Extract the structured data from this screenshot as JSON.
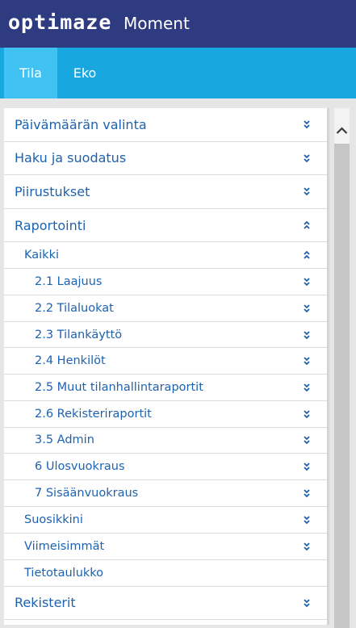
{
  "header": {
    "logo_text": "optimaze",
    "app_title": "Moment"
  },
  "tabs": [
    {
      "label": "Tila",
      "active": true
    },
    {
      "label": "Eko",
      "active": false
    }
  ],
  "menu": [
    {
      "label": "Päivämäärän valinta",
      "level": 0,
      "expanded": false
    },
    {
      "label": "Haku ja suodatus",
      "level": 0,
      "expanded": false
    },
    {
      "label": "Piirustukset",
      "level": 0,
      "expanded": false
    },
    {
      "label": "Raportointi",
      "level": 0,
      "expanded": true
    },
    {
      "label": "Kaikki",
      "level": 1,
      "expanded": true
    },
    {
      "label": "2.1 Laajuus",
      "level": 2,
      "expanded": false
    },
    {
      "label": "2.2 Tilaluokat",
      "level": 2,
      "expanded": false
    },
    {
      "label": "2.3 Tilankäyttö",
      "level": 2,
      "expanded": false
    },
    {
      "label": "2.4 Henkilöt",
      "level": 2,
      "expanded": false
    },
    {
      "label": "2.5 Muut tilanhallintaraportit",
      "level": 2,
      "expanded": false
    },
    {
      "label": "2.6 Rekisteriraportit",
      "level": 2,
      "expanded": false
    },
    {
      "label": "3.5 Admin",
      "level": 2,
      "expanded": false
    },
    {
      "label": "6 Ulosvuokraus",
      "level": 2,
      "expanded": false
    },
    {
      "label": "7 Sisäänvuokraus",
      "level": 2,
      "expanded": false
    },
    {
      "label": "Suosikkini",
      "level": 1,
      "expanded": false
    },
    {
      "label": "Viimeisimmät",
      "level": 1,
      "expanded": false
    },
    {
      "label": "Tietotaulukko",
      "level": 1,
      "expanded": null
    },
    {
      "label": "Rekisterit",
      "level": 0,
      "expanded": false
    }
  ],
  "icons": {
    "expand": "double-chevron-down-icon",
    "collapse": "double-chevron-up-icon",
    "scroll_up": "chevron-up-icon"
  },
  "colors": {
    "header_bg": "#2e3b80",
    "tabbar_bg": "#19a7e0",
    "tab_active_bg": "#40c3f3",
    "link_text": "#1d62b0",
    "chevron": "#1f5fae"
  }
}
